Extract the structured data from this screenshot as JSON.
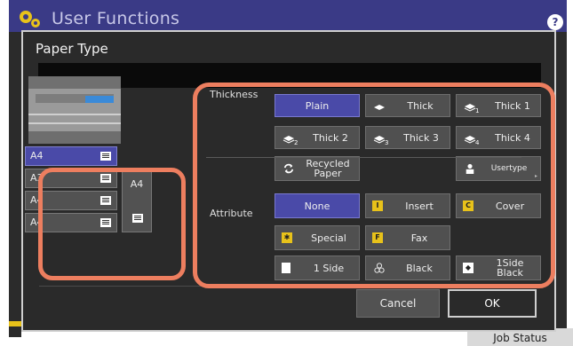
{
  "app": {
    "title": "User Functions",
    "help_label": "?",
    "job_status": "Job Status"
  },
  "dialog": {
    "title": "Paper Type",
    "cancel_label": "Cancel",
    "ok_label": "OK"
  },
  "trays": {
    "items": [
      {
        "label": "A4",
        "selected": true
      },
      {
        "label": "A3",
        "selected": false
      },
      {
        "label": "A4",
        "selected": false
      },
      {
        "label": "A4",
        "selected": false
      }
    ],
    "bypass_label": "A4"
  },
  "thickness": {
    "label": "Thickness",
    "buttons": {
      "plain": "Plain",
      "thick": "Thick",
      "thick1": "Thick 1",
      "thick2": "Thick 2",
      "thick3": "Thick 3",
      "thick4": "Thick 4",
      "recycled_line1": "Recycled",
      "recycled_line2": "Paper",
      "usertype": "Usertype"
    },
    "subscripts": {
      "thick1": "1",
      "thick2": "2",
      "thick3": "3",
      "thick4": "4"
    },
    "selected": "plain"
  },
  "attribute": {
    "label": "Attribute",
    "buttons": {
      "none": "None",
      "insert": "Insert",
      "cover": "Cover",
      "special": "Special",
      "fax": "Fax",
      "one_side": "1 Side",
      "black": "Black",
      "one_side_black_line1": "1Side",
      "one_side_black_line2": "Black"
    },
    "selected": "none"
  },
  "colors": {
    "accent": "#4a4aa8",
    "highlight": "#ed7e5f",
    "title_bar": "#3a3a86",
    "button": "#505050",
    "icon_yellow": "#e8c21a"
  }
}
